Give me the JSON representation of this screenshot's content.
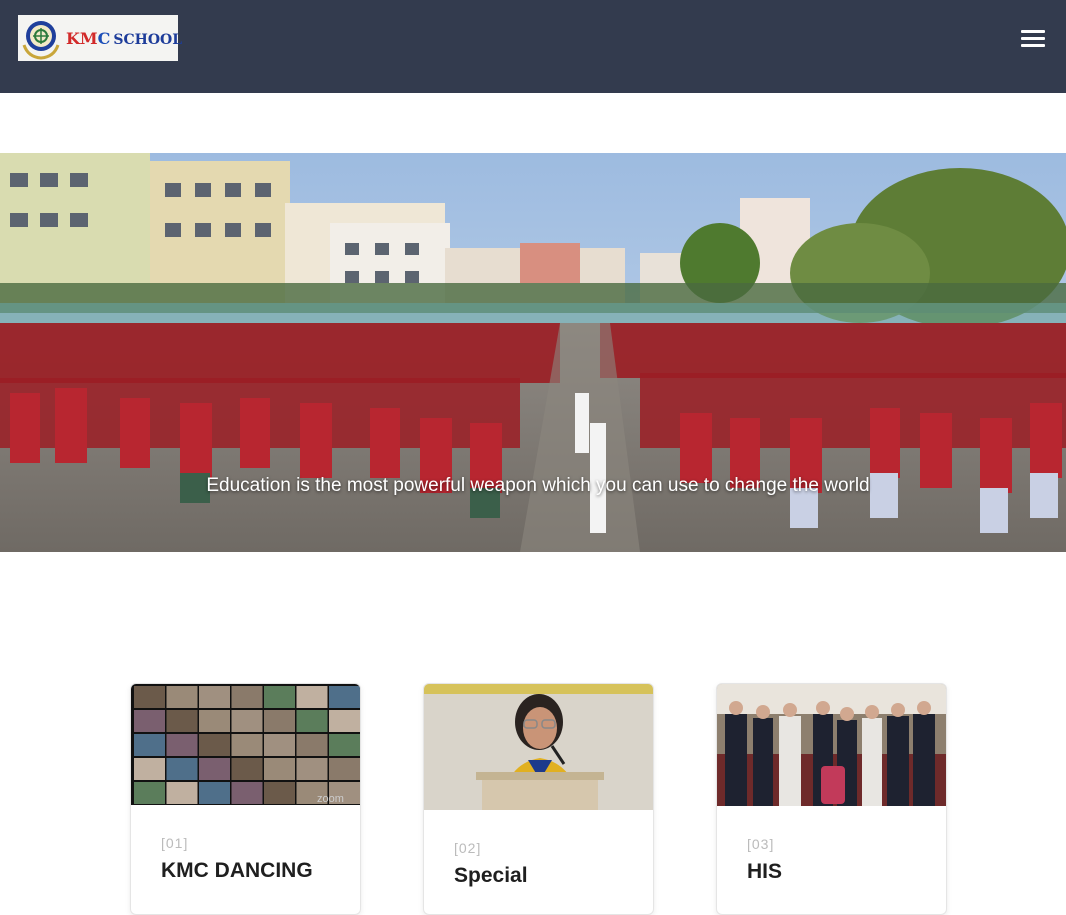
{
  "header": {
    "logo": {
      "text_k": "K",
      "text_m": "M",
      "text_c": "C",
      "text_school": "SCHOOL"
    },
    "menu_icon": "hamburger-icon"
  },
  "hero": {
    "caption": "Education is the most powerful weapon which you can use to change the world"
  },
  "cards": [
    {
      "number": "[01]",
      "title": "KMC DANCING",
      "image_label": "zoom"
    },
    {
      "number": "[02]",
      "title": "Special",
      "image_label": ""
    },
    {
      "number": "[03]",
      "title": "HIS",
      "image_label": ""
    }
  ],
  "colors": {
    "header_bg": "#333b4e",
    "accent_red": "#d22a2a",
    "accent_blue": "#1d4fb8"
  }
}
